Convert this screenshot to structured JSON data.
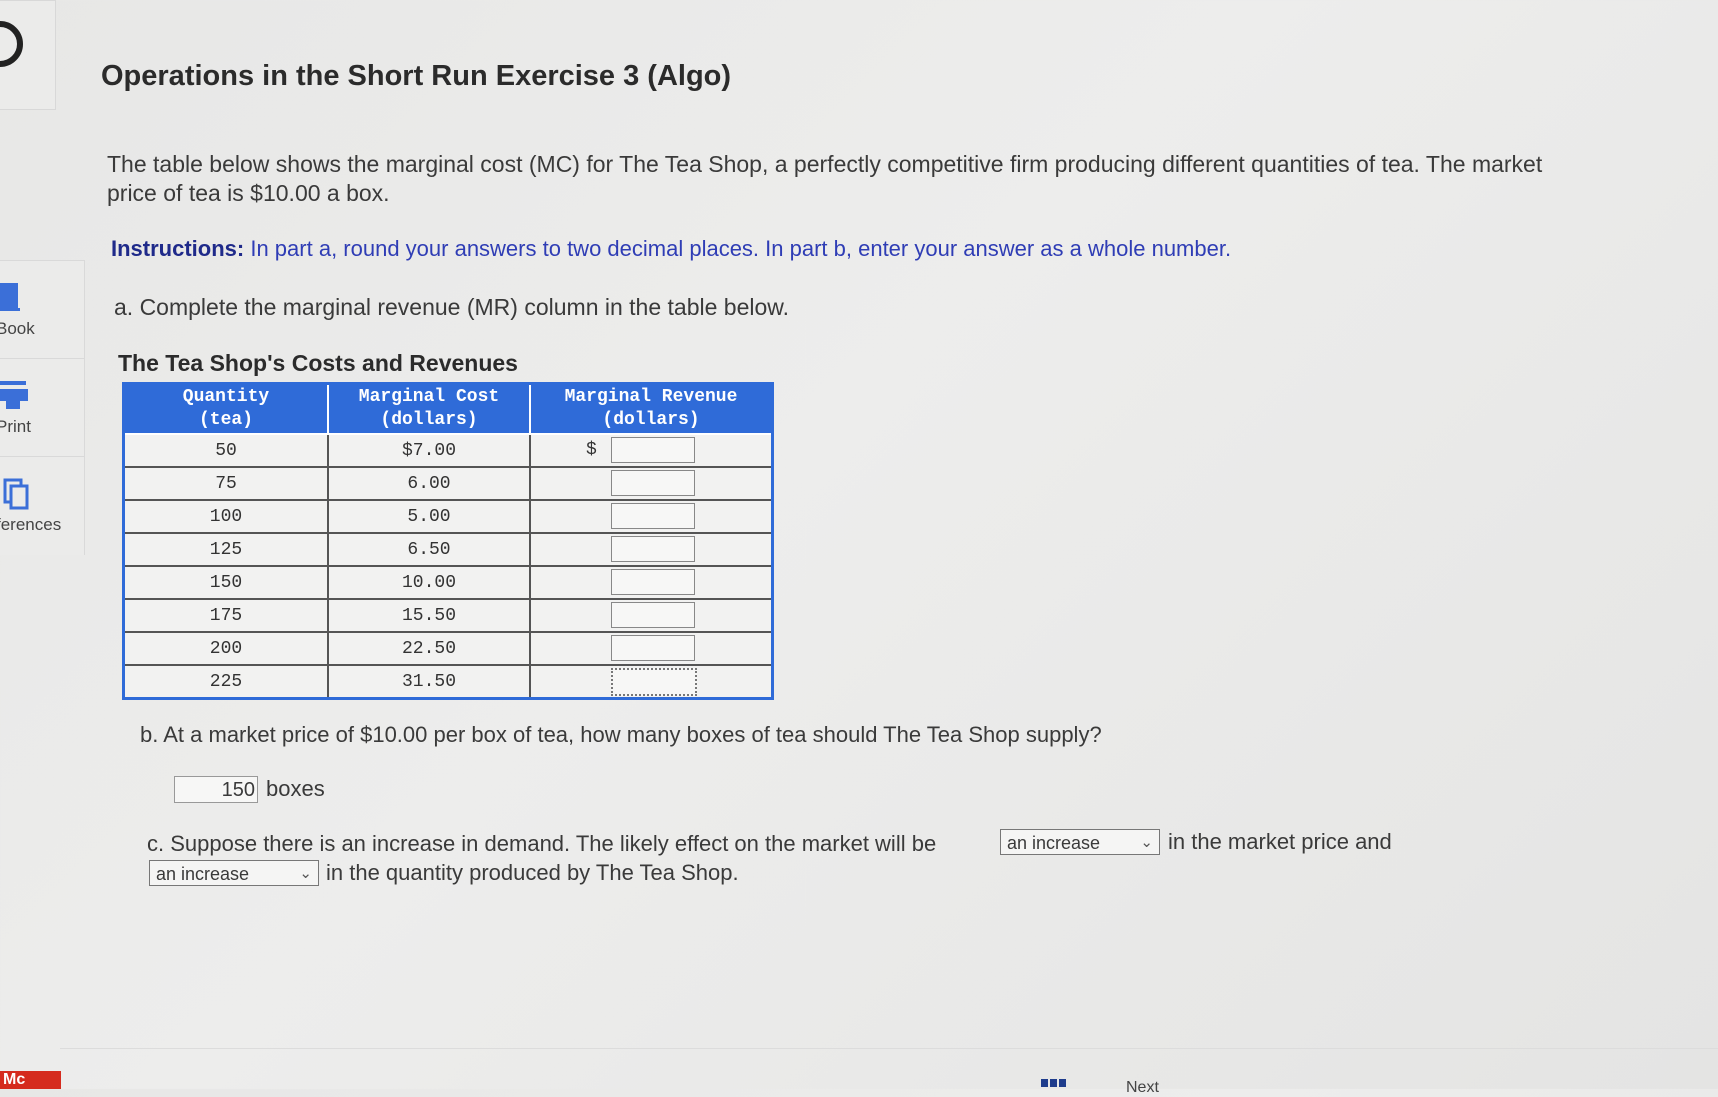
{
  "sidebar": {
    "tools": [
      {
        "label": "Book",
        "icon": "ebook-icon"
      },
      {
        "label": "Print",
        "icon": "printer-icon"
      },
      {
        "label": "ferences",
        "icon": "references-icon"
      }
    ],
    "logo": "Mc"
  },
  "title": "Operations in the Short Run Exercise 3 (Algo)",
  "intro": "The table below shows the marginal cost (MC) for The Tea Shop, a perfectly competitive firm producing different quantities of tea. The market price of tea is $10.00 a box.",
  "instructions": {
    "label": "Instructions:",
    "text": " In part a, round your answers to two decimal places. In part b, enter your answer as a whole number."
  },
  "part_a": "a. Complete the marginal revenue (MR) column in the table below.",
  "table": {
    "caption": "The Tea Shop's Costs and Revenues",
    "headers": [
      {
        "line1": "Quantity",
        "line2": "(tea)"
      },
      {
        "line1": "Marginal Cost",
        "line2": "(dollars)"
      },
      {
        "line1": "Marginal Revenue",
        "line2": "(dollars)"
      }
    ],
    "rows": [
      {
        "qty": "50",
        "mc": "$7.00",
        "prefix": "$",
        "mr": ""
      },
      {
        "qty": "75",
        "mc": "6.00",
        "prefix": "",
        "mr": ""
      },
      {
        "qty": "100",
        "mc": "5.00",
        "prefix": "",
        "mr": ""
      },
      {
        "qty": "125",
        "mc": "6.50",
        "prefix": "",
        "mr": ""
      },
      {
        "qty": "150",
        "mc": "10.00",
        "prefix": "",
        "mr": ""
      },
      {
        "qty": "175",
        "mc": "15.50",
        "prefix": "",
        "mr": ""
      },
      {
        "qty": "200",
        "mc": "22.50",
        "prefix": "",
        "mr": ""
      },
      {
        "qty": "225",
        "mc": "31.50",
        "prefix": "",
        "mr": ""
      }
    ]
  },
  "part_b": {
    "question": "b. At a market price of $10.00 per box of tea, how many boxes of tea should The Tea Shop supply?",
    "answer": "150",
    "unit": "boxes"
  },
  "part_c": {
    "text1": "c. Suppose there is an increase in demand. The likely effect on the market will be",
    "select1": "an increase",
    "text2": "in the market price and",
    "select2": "an increase",
    "text3": "in the quantity produced by The Tea Shop."
  },
  "footer": {
    "next": "Next"
  }
}
